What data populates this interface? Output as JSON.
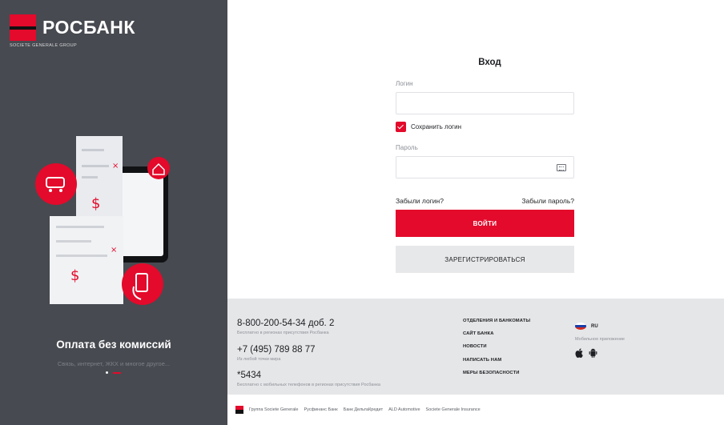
{
  "brand": {
    "name": "РОСБАНК",
    "subtitle": "SOCIETE GENERALE GROUP",
    "color": "#e30a2b"
  },
  "promo": {
    "title": "Оплата без комиссий",
    "subtitle": "Связь, интернет, ЖКХ и многое другое..."
  },
  "login": {
    "title": "Вход",
    "login_label": "Логин",
    "login_value": "",
    "remember_label": "Сохранить логин",
    "remember_checked": true,
    "password_label": "Пароль",
    "password_value": "",
    "forgot_login": "Забыли логин?",
    "forgot_password": "Забыли пароль?",
    "submit_label": "ВОЙТИ",
    "register_label": "ЗАРЕГИСТРИРОВАТЬСЯ"
  },
  "footer": {
    "phones": [
      {
        "number": "8-800-200-54-34 доб. 2",
        "note": "Бесплатно в регионах присутствия Росбанка"
      },
      {
        "number": "+7 (495) 789 88 77",
        "note": "Из любой точки мира"
      },
      {
        "number": "*5434",
        "note": "Бесплатно с мобильных телефонов в регионах присутствия Росбанка"
      }
    ],
    "links": [
      "ОТДЕЛЕНИЯ И БАНКОМАТЫ",
      "САЙТ БАНКА",
      "НОВОСТИ",
      "НАПИСАТЬ НАМ",
      "МЕРЫ БЕЗОПАСНОСТИ"
    ],
    "language": "RU",
    "apps_label": "Мобильное приложение"
  },
  "partners": [
    "Группа Societe Generale",
    "Русфинанс Банк",
    "Банк ДельтаКредит",
    "ALD Automotive",
    "Societe Generale Insurance"
  ]
}
